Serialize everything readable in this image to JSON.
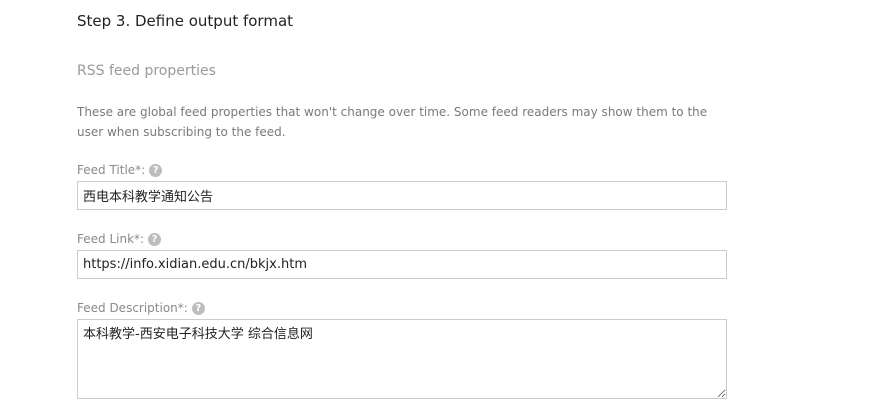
{
  "step": {
    "title": "Step 3. Define output format"
  },
  "section": {
    "title": "RSS feed properties",
    "description": "These are global feed properties that won't change over time. Some feed readers may show them to the user when subscribing to the feed."
  },
  "fields": {
    "title": {
      "label": "Feed Title",
      "required_mark": "*:",
      "help": "?",
      "value": "西电本科教学通知公告"
    },
    "link": {
      "label": "Feed Link",
      "required_mark": "*:",
      "help": "?",
      "value": "https://info.xidian.edu.cn/bkjx.htm"
    },
    "description": {
      "label": "Feed Description",
      "required_mark": "*:",
      "help": "?",
      "value": "本科教学-西安电子科技大学 综合信息网"
    }
  }
}
